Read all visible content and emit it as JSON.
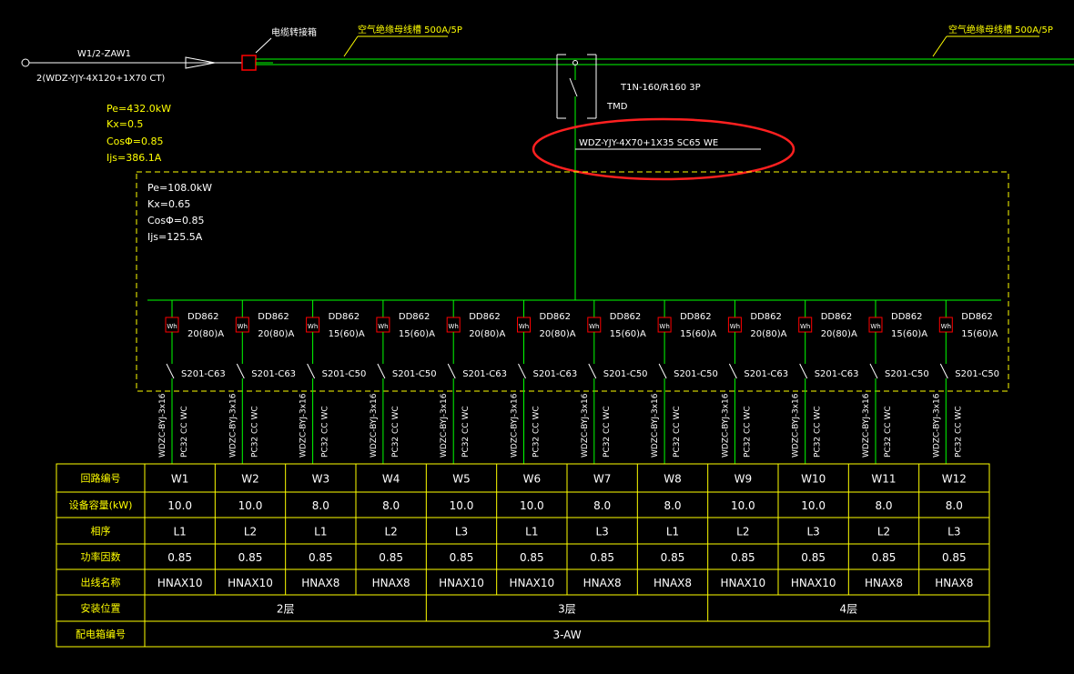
{
  "feeder": {
    "circuit_id": "W1/2-ZAW1",
    "cable_spec": "2(WDZ-YJY-4X120+1X70 CT)",
    "junction_label": "电缆转接箱",
    "busway_left": "空气绝缘母线槽 500A/5P",
    "busway_right": "空气绝缘母线槽 500A/5P"
  },
  "main_calc": {
    "pe": "Pe=432.0kW",
    "kx": "Kx=0.5",
    "cos": "CosΦ=0.85",
    "ijs": "Ijs=386.1A"
  },
  "plug_breaker": {
    "model": "T1N-160/R160 3P",
    "trip": "TMD"
  },
  "branch_cable": "WDZ-YJY-4X70+1X35 SC65 WE",
  "panel_calc": {
    "pe": "Pe=108.0kW",
    "kx": "Kx=0.65",
    "cos": "CosΦ=0.85",
    "ijs": "Ijs=125.5A"
  },
  "circuits": [
    {
      "id": "W1",
      "meter": "DD862",
      "rating": "20(80)A",
      "breaker": "S201-C63",
      "wire": "WDZC-BYJ-3x16",
      "conduit": "PC32 CC WC",
      "capacity": "10.0",
      "phase": "L1",
      "pf": "0.85",
      "name": "HNAX10"
    },
    {
      "id": "W2",
      "meter": "DD862",
      "rating": "20(80)A",
      "breaker": "S201-C63",
      "wire": "WDZC-BYJ-3x16",
      "conduit": "PC32 CC WC",
      "capacity": "10.0",
      "phase": "L2",
      "pf": "0.85",
      "name": "HNAX10"
    },
    {
      "id": "W3",
      "meter": "DD862",
      "rating": "15(60)A",
      "breaker": "S201-C50",
      "wire": "WDZC-BYJ-3x16",
      "conduit": "PC32 CC WC",
      "capacity": "8.0",
      "phase": "L1",
      "pf": "0.85",
      "name": "HNAX8"
    },
    {
      "id": "W4",
      "meter": "DD862",
      "rating": "15(60)A",
      "breaker": "S201-C50",
      "wire": "WDZC-BYJ-3x16",
      "conduit": "PC32 CC WC",
      "capacity": "8.0",
      "phase": "L2",
      "pf": "0.85",
      "name": "HNAX8"
    },
    {
      "id": "W5",
      "meter": "DD862",
      "rating": "20(80)A",
      "breaker": "S201-C63",
      "wire": "WDZC-BYJ-3x16",
      "conduit": "PC32 CC WC",
      "capacity": "10.0",
      "phase": "L3",
      "pf": "0.85",
      "name": "HNAX10"
    },
    {
      "id": "W6",
      "meter": "DD862",
      "rating": "20(80)A",
      "breaker": "S201-C63",
      "wire": "WDZC-BYJ-3x16",
      "conduit": "PC32 CC WC",
      "capacity": "10.0",
      "phase": "L1",
      "pf": "0.85",
      "name": "HNAX10"
    },
    {
      "id": "W7",
      "meter": "DD862",
      "rating": "15(60)A",
      "breaker": "S201-C50",
      "wire": "WDZC-BYJ-3x16",
      "conduit": "PC32 CC WC",
      "capacity": "8.0",
      "phase": "L3",
      "pf": "0.85",
      "name": "HNAX8"
    },
    {
      "id": "W8",
      "meter": "DD862",
      "rating": "15(60)A",
      "breaker": "S201-C50",
      "wire": "WDZC-BYJ-3x16",
      "conduit": "PC32 CC WC",
      "capacity": "8.0",
      "phase": "L1",
      "pf": "0.85",
      "name": "HNAX8"
    },
    {
      "id": "W9",
      "meter": "DD862",
      "rating": "20(80)A",
      "breaker": "S201-C63",
      "wire": "WDZC-BYJ-3x16",
      "conduit": "PC32 CC WC",
      "capacity": "10.0",
      "phase": "L2",
      "pf": "0.85",
      "name": "HNAX10"
    },
    {
      "id": "W10",
      "meter": "DD862",
      "rating": "20(80)A",
      "breaker": "S201-C63",
      "wire": "WDZC-BYJ-3x16",
      "conduit": "PC32 CC WC",
      "capacity": "10.0",
      "phase": "L3",
      "pf": "0.85",
      "name": "HNAX10"
    },
    {
      "id": "W11",
      "meter": "DD862",
      "rating": "15(60)A",
      "breaker": "S201-C50",
      "wire": "WDZC-BYJ-3x16",
      "conduit": "PC32 CC WC",
      "capacity": "8.0",
      "phase": "L2",
      "pf": "0.85",
      "name": "HNAX8"
    },
    {
      "id": "W12",
      "meter": "DD862",
      "rating": "15(60)A",
      "breaker": "S201-C50",
      "wire": "WDZC-BYJ-3x16",
      "conduit": "PC32 CC WC",
      "capacity": "8.0",
      "phase": "L3",
      "pf": "0.85",
      "name": "HNAX8"
    }
  ],
  "table": {
    "row_headers": [
      "回路编号",
      "设备容量(kW)",
      "相序",
      "功率因数",
      "出线名称",
      "安装位置",
      "配电箱编号"
    ],
    "locations": [
      "2层",
      "3层",
      "4层"
    ],
    "box_id": "3-AW"
  },
  "colors": {
    "background": "#000000",
    "wire": "#00ff00",
    "text": "#ffffff",
    "table_and_dash": "#ffff00",
    "highlight_ellipse": "#ff2020",
    "switch_box": "#ff0000"
  }
}
